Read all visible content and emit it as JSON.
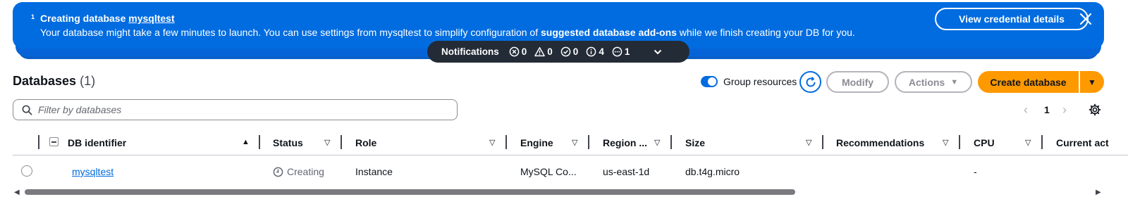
{
  "flash": {
    "count": "1",
    "title_prefix": "Creating database ",
    "title_db": "mysqltest",
    "message_part1": "Your database might take a few minutes to launch. You can use settings from mysqltest to simplify configuration of ",
    "message_bold": "suggested database add-ons",
    "message_part2": " while we finish creating your DB for you.",
    "view_button": "View credential details",
    "close_icon": "close-icon"
  },
  "notifications": {
    "label": "Notifications",
    "error": "0",
    "warning": "0",
    "success": "0",
    "info": "4",
    "in_progress": "1"
  },
  "header": {
    "title": "Databases",
    "count": "(1)",
    "group_toggle_label": "Group resources",
    "group_toggle_on": true,
    "modify": "Modify",
    "actions": "Actions",
    "create": "Create database"
  },
  "filter": {
    "placeholder": "Filter by databases"
  },
  "pagination": {
    "page": "1"
  },
  "table": {
    "columns": [
      "DB identifier",
      "Status",
      "Role",
      "Engine",
      "Region ...",
      "Size",
      "Recommendations",
      "CPU",
      "Current act"
    ],
    "rows": [
      {
        "db_identifier": "mysqltest",
        "status": "Creating",
        "role": "Instance",
        "engine": "MySQL Co...",
        "region": "us-east-1d",
        "size": "db.t4g.micro",
        "recommendations": "",
        "cpu": "-"
      }
    ]
  },
  "colors": {
    "flash_blue": "#006ce0",
    "notif_bg": "#232b37",
    "primary_orange": "#ff9900",
    "link_blue": "#006ce0"
  }
}
